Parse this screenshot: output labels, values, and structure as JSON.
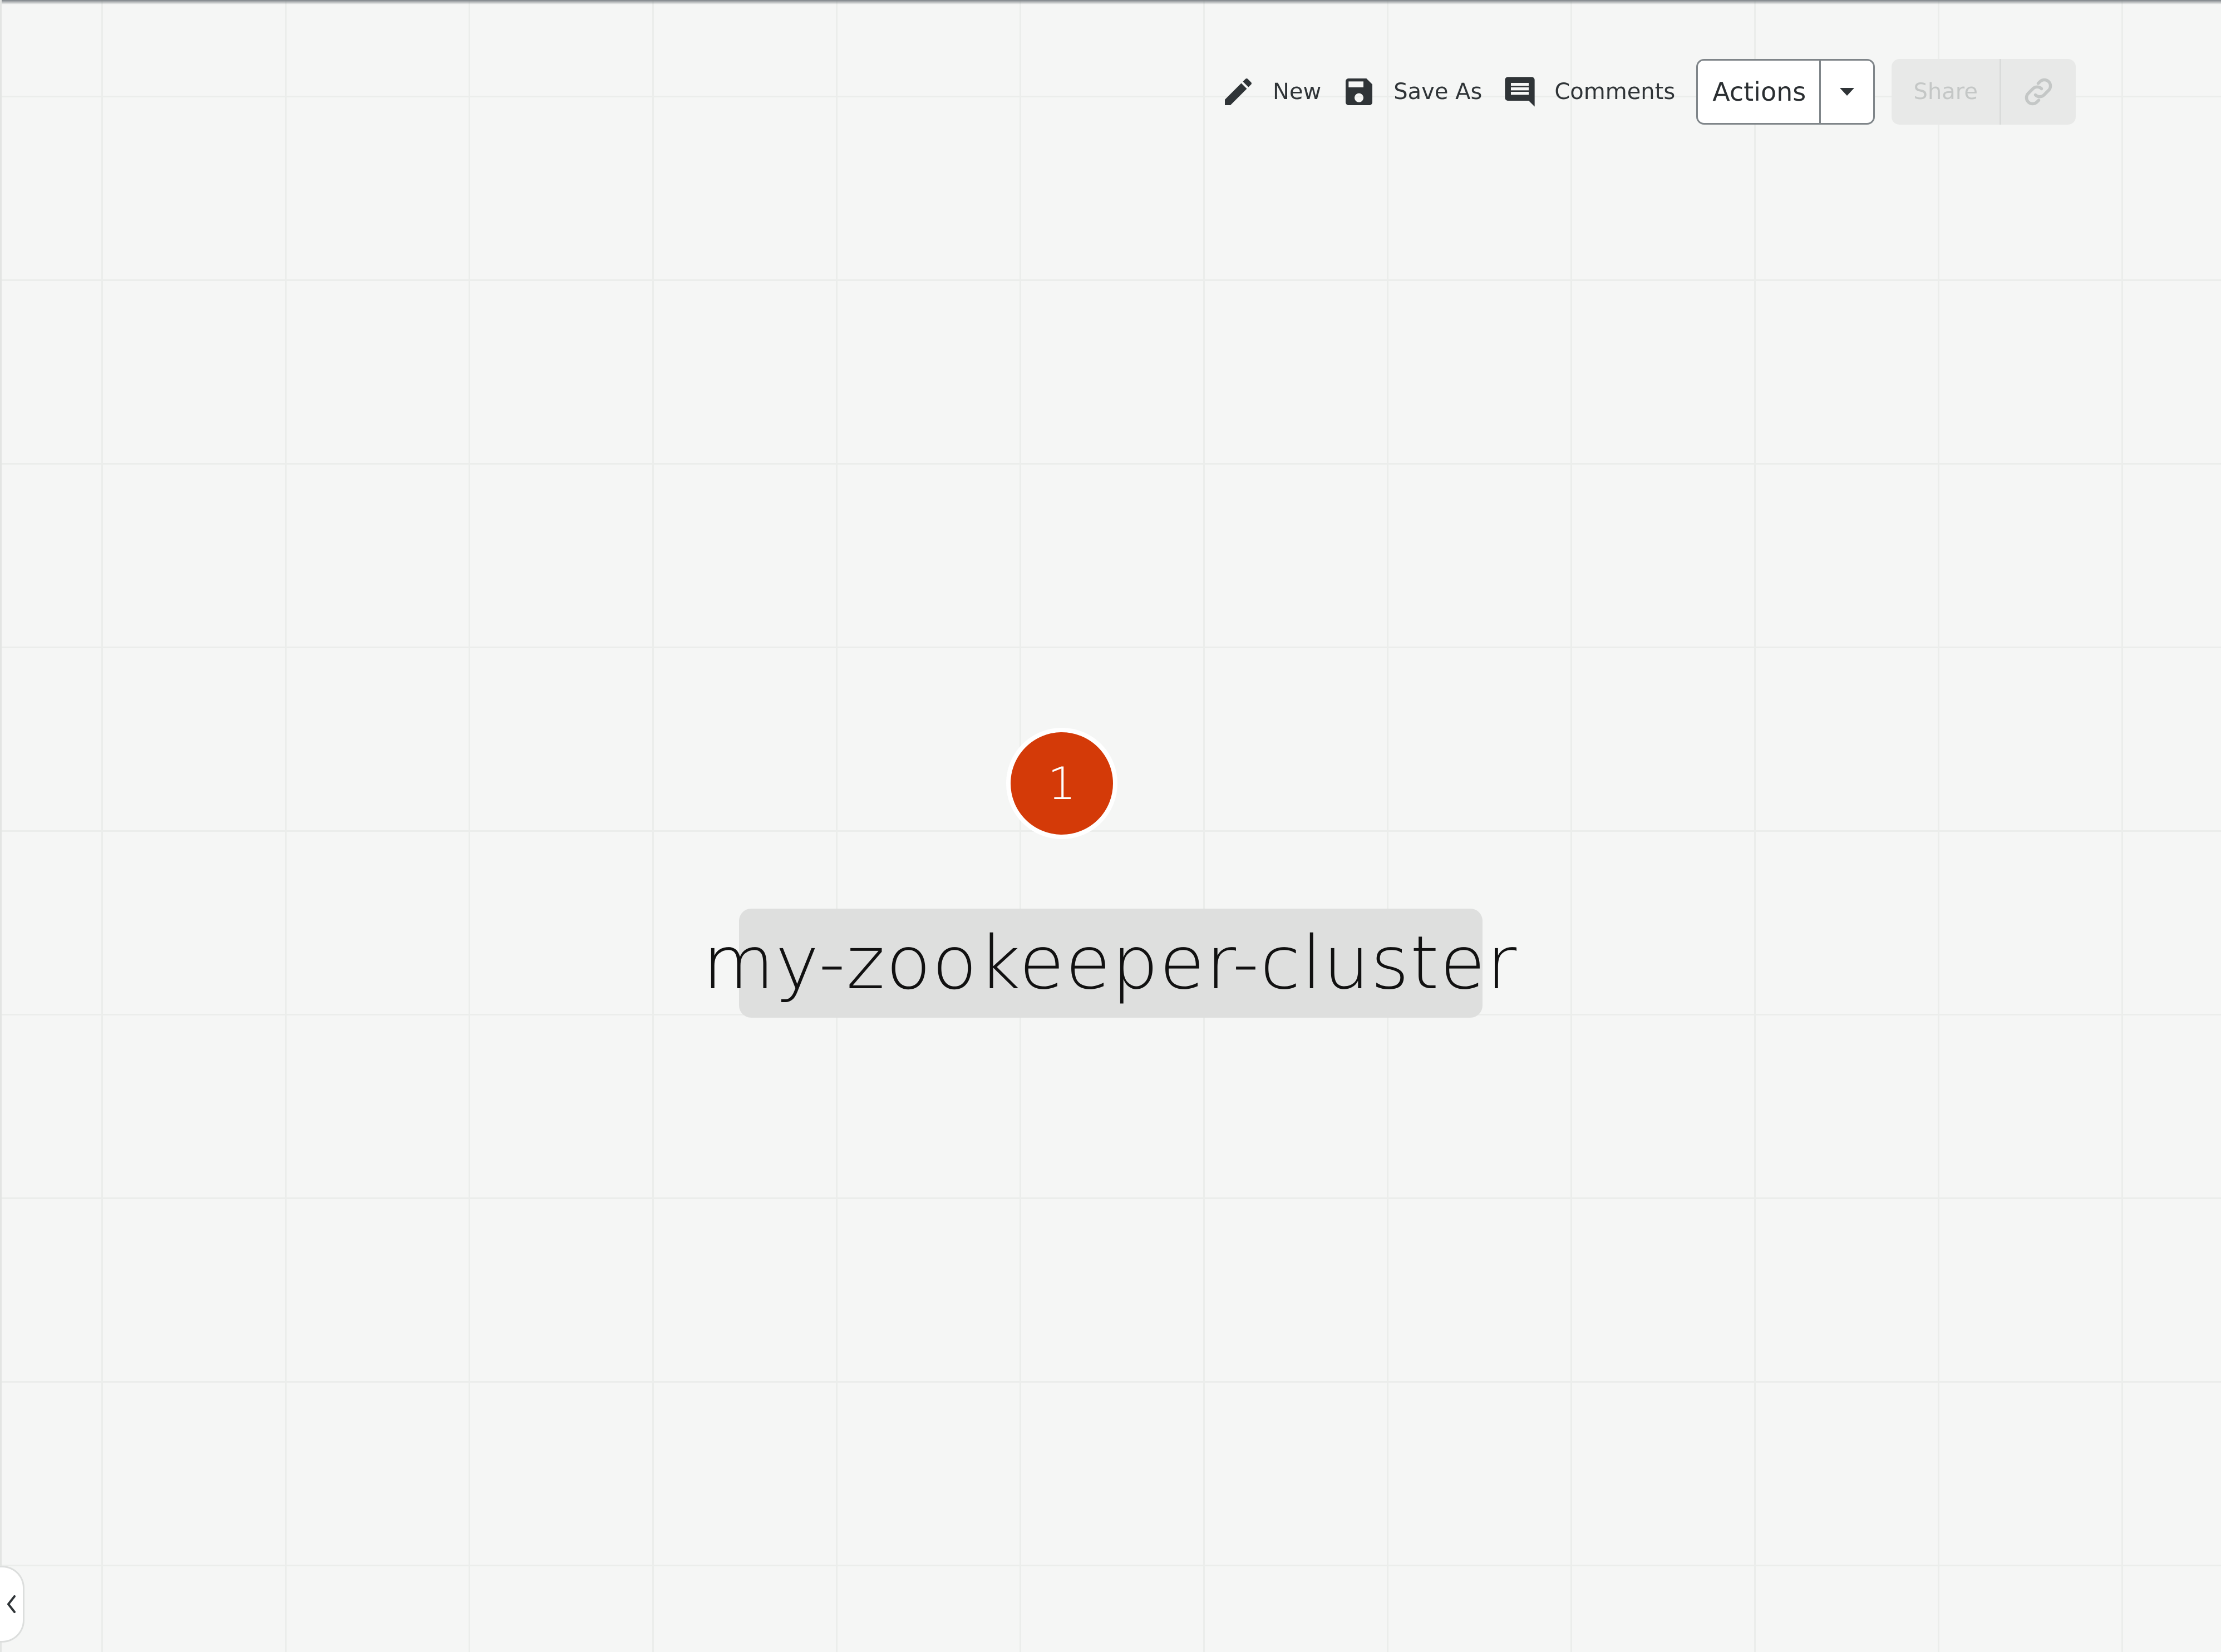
{
  "toolbar": {
    "new_label": "New",
    "new_icon": "pencil-icon",
    "save_as_label": "Save As",
    "save_as_icon": "floppy-disk-icon",
    "comments_label": "Comments",
    "comments_icon": "comment-icon",
    "actions_label": "Actions",
    "actions_icon": "chevron-down-icon",
    "share_label": "Share",
    "share_enabled": false,
    "link_icon": "link-icon"
  },
  "canvas": {
    "node_badge": "1",
    "node_label": "my-zookeeper-cluster"
  },
  "sidebar_toggle": {
    "icon": "chevron-left-icon"
  },
  "colors": {
    "badge": "#d43a08",
    "background": "#f5f6f5",
    "label_highlight": "#dedfde",
    "icon_dark": "#2f3437"
  }
}
